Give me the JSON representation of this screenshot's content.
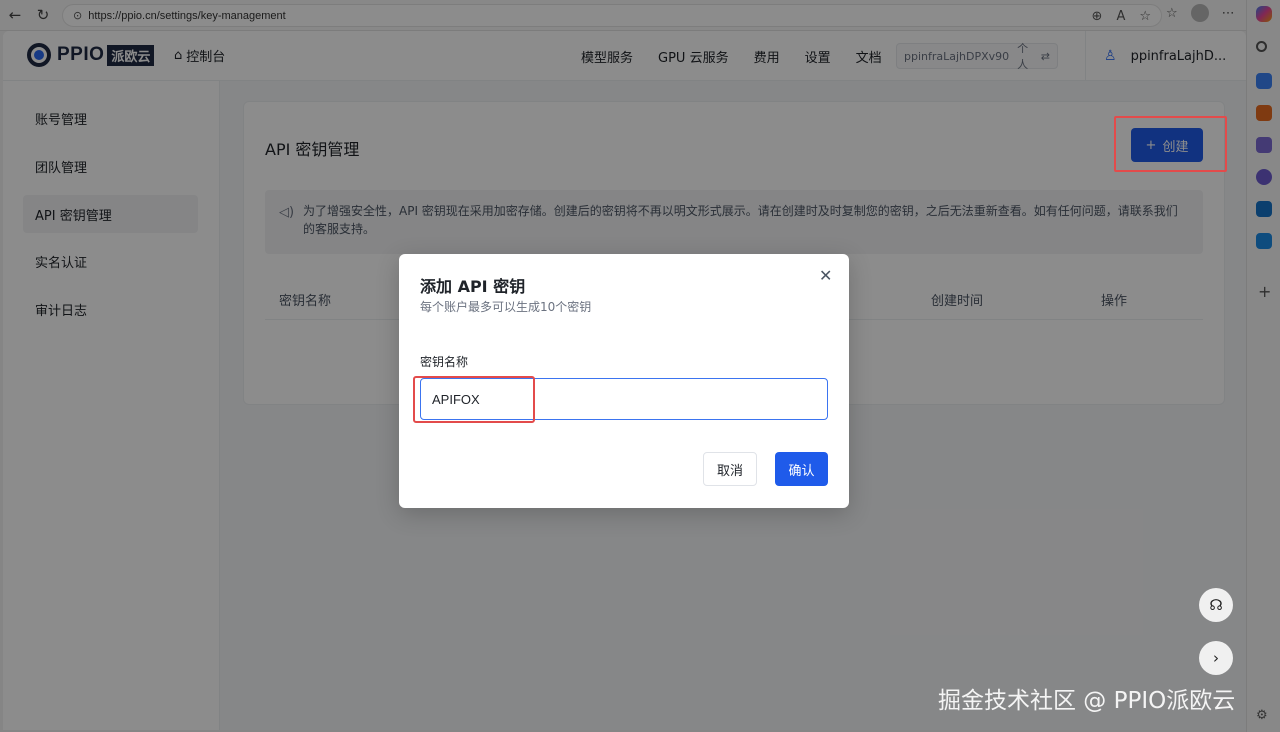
{
  "browser": {
    "url": "https://ppio.cn/settings/key-management"
  },
  "topnav": {
    "logo_text": "PPIO",
    "logo_badge": "派欧云",
    "home_label": "控制台",
    "items": [
      "模型服务",
      "GPU 云服务",
      "费用",
      "设置",
      "文档"
    ],
    "account_id": "ppinfraLajhDPXv90",
    "account_type": "个人",
    "user_name": "ppinfraLajhD..."
  },
  "sidebar": {
    "items": [
      {
        "label": "账号管理"
      },
      {
        "label": "团队管理"
      },
      {
        "label": "API 密钥管理"
      },
      {
        "label": "实名认证"
      },
      {
        "label": "审计日志"
      }
    ]
  },
  "main": {
    "title": "API 密钥管理",
    "create_label": "创建",
    "notice": "为了增强安全性，API 密钥现在采用加密存储。创建后的密钥将不再以明文形式展示。请在创建时及时复制您的密钥，之后无法重新查看。如有任何问题，请联系我们的客服支持。",
    "columns": [
      "密钥名称",
      "创建时间",
      "操作"
    ]
  },
  "modal": {
    "title": "添加 API 密钥",
    "subtitle": "每个账户最多可以生成10个密钥",
    "field_label": "密钥名称",
    "field_value": "APIFOX",
    "cancel_label": "取消",
    "confirm_label": "确认"
  },
  "watermark": "掘金技术社区 @ PPIO派欧云",
  "colors": {
    "primary": "#1f5bea",
    "highlight": "#e34b4b"
  }
}
